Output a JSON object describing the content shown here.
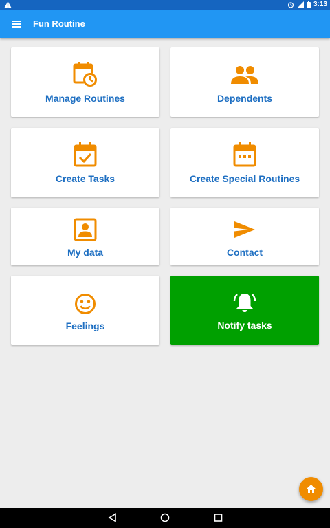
{
  "status": {
    "time": "3:13"
  },
  "appbar": {
    "title": "Fun Routine"
  },
  "cards": [
    {
      "label": "Manage Routines",
      "icon": "calendar-clock-icon"
    },
    {
      "label": "Dependents",
      "icon": "people-icon"
    },
    {
      "label": "Create Tasks",
      "icon": "calendar-check-icon"
    },
    {
      "label": "Create Special Routines",
      "icon": "calendar-dots-icon"
    },
    {
      "label": "My data",
      "icon": "account-box-icon"
    },
    {
      "label": "Contact",
      "icon": "send-icon"
    },
    {
      "label": "Feelings",
      "icon": "smiley-icon"
    },
    {
      "label": "Notify tasks",
      "icon": "bell-ringing-icon"
    }
  ],
  "colors": {
    "accent": "#2196f3",
    "icon": "#f08c00",
    "label": "#1e6fc2",
    "notify": "#00a000"
  }
}
